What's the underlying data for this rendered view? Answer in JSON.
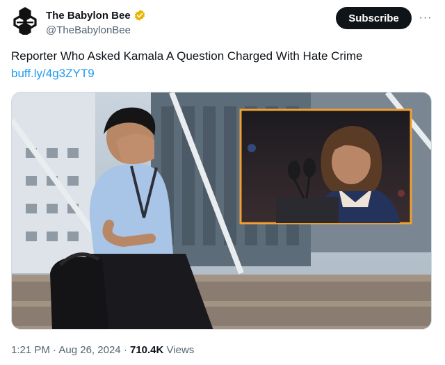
{
  "account": {
    "display_name": "The Babylon Bee",
    "handle": "@TheBabylonBee",
    "verified": true,
    "avatar_icon": "bee-logo-icon",
    "badge_color": "#e8b500"
  },
  "actions": {
    "subscribe_label": "Subscribe",
    "more_icon": "more-options-icon",
    "more_glyph": "···"
  },
  "tweet": {
    "text": "Reporter Who Asked Kamala A Question Charged With Hate Crime",
    "link": "buff.ly/4g3ZYT9",
    "link_color": "#1d9bf0"
  },
  "footer": {
    "time": "1:21 PM",
    "separator": "·",
    "date": "Aug 26, 2024",
    "views_count": "710.4K",
    "views_label": "Views"
  },
  "media": {
    "inset_border_color": "#f0a030"
  }
}
